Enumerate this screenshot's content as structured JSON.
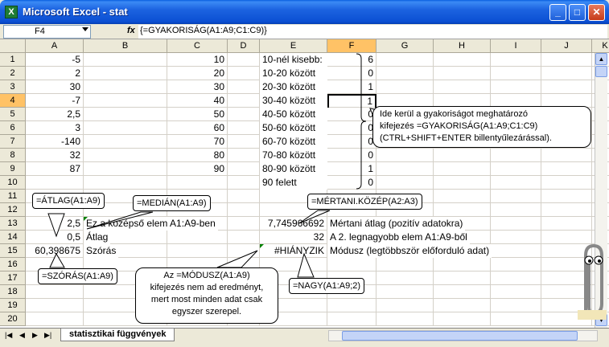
{
  "window": {
    "title": "Microsoft Excel - stat",
    "app_icon": "X",
    "min": "_",
    "max": "□",
    "close": "✕"
  },
  "formula_bar": {
    "name_box": "F4",
    "fx": "fx",
    "formula": "{=GYAKORISÁG(A1:A9;C1:C9)}"
  },
  "columns": [
    "A",
    "B",
    "C",
    "D",
    "E",
    "F",
    "G",
    "H",
    "I",
    "J",
    "K"
  ],
  "rows": [
    "1",
    "2",
    "3",
    "4",
    "5",
    "6",
    "7",
    "8",
    "9",
    "10",
    "11",
    "12",
    "13",
    "14",
    "15",
    "16",
    "17",
    "18",
    "19",
    "20"
  ],
  "cells": {
    "A": [
      "-5",
      "2",
      "30",
      "-7",
      "2,5",
      "3",
      "-140",
      "32",
      "87",
      "",
      "",
      "",
      "2,5",
      "0,5",
      "60,398675",
      "",
      "",
      "",
      "",
      ""
    ],
    "B": [
      "",
      "",
      "",
      "",
      "",
      "",
      "",
      "",
      "",
      "",
      "",
      "",
      "Ez a középső elem A1:A9-ben",
      "Átlag",
      "Szórás",
      "",
      "",
      "",
      "",
      ""
    ],
    "C": [
      "10",
      "20",
      "30",
      "40",
      "50",
      "60",
      "70",
      "80",
      "90",
      "",
      "",
      "",
      "",
      "",
      "",
      "",
      "",
      "",
      "",
      ""
    ],
    "E": [
      "10-nél kisebb:",
      "10-20 között",
      "20-30 között",
      "30-40 között",
      "40-50 között",
      "50-60 között",
      "60-70 között",
      "70-80 között",
      "80-90 között",
      "90 felett",
      "",
      "",
      "7,745966692",
      "32",
      "#HIÁNYZIK",
      "",
      "",
      "",
      "",
      ""
    ],
    "F": [
      "6",
      "0",
      "1",
      "1",
      "0",
      "0",
      "0",
      "0",
      "1",
      "0",
      "",
      "",
      "Mértani átlag (pozitív adatokra)",
      "A 2. legnagyobb elem A1:A9-ből",
      "Módusz (legtöbbször előforduló adat)",
      "",
      "",
      "",
      "",
      ""
    ]
  },
  "callouts": {
    "atlag": "=ÁTLAG(A1:A9)",
    "median": "=MEDIÁN(A1:A9)",
    "mertani": "=MÉRTANI.KÖZÉP(A2:A3)",
    "szoras": "=SZÓRÁS(A1:A9)",
    "nagy": "=NAGY(A1:A9;2)",
    "modusz": [
      "Az =MÓDUSZ(A1:A9)",
      "kifejezés nem ad eredményt,",
      "mert most minden adat csak",
      "egyszer szerepel."
    ],
    "gyak": [
      "Ide kerül a gyakoriságot meghatározó",
      "kifejezés =GYAKORISÁG(A1:A9;C1:C9)",
      "(CTRL+SHIFT+ENTER billentyűlezárással)."
    ]
  },
  "sheet_tab": "statisztikai függvények",
  "tab_nav": [
    "|◀",
    "◀",
    "▶",
    "▶|"
  ],
  "colors": {
    "accent": "#0b4fd3",
    "selected_header": "#ffc266",
    "green_marker": "#008000"
  }
}
